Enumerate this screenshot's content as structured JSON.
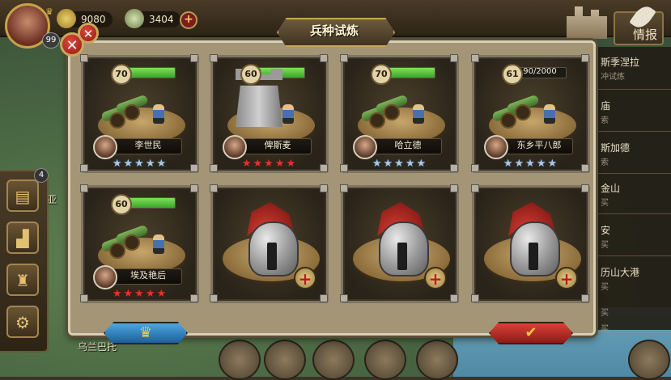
{
  "top_bar": {
    "player_level": "99",
    "gold": "9080",
    "food": "3404"
  },
  "right_panel": {
    "intel_label": "情报",
    "items": [
      {
        "title": "斯季涅拉",
        "sub": "冲试炼"
      },
      {
        "title": "庙",
        "sub": "索"
      },
      {
        "title": "斯加德",
        "sub": "索"
      },
      {
        "title": "金山",
        "sub": "买"
      },
      {
        "title": "安",
        "sub": "买"
      },
      {
        "title": "历山大港",
        "sub": "买"
      },
      {
        "title": "",
        "sub": "买"
      },
      {
        "title": "",
        "sub": "买"
      }
    ]
  },
  "left_panel": {
    "badge_count": "4",
    "map_label_1": "伯利亚",
    "map_label_2": "乌兰巴托"
  },
  "panel": {
    "title": "兵种试炼",
    "close_symbol": "✕",
    "cards": [
      {
        "level": "70",
        "progress": 1.0,
        "progress_text": "",
        "name": "李世民",
        "stars": "★★★★★",
        "star_color": "blue",
        "unit": "cannon"
      },
      {
        "level": "60",
        "progress": 1.0,
        "progress_text": "",
        "name": "俾斯麦",
        "stars": "★★★★★",
        "star_color": "red",
        "unit": "tower"
      },
      {
        "level": "70",
        "progress": 1.0,
        "progress_text": "",
        "name": "哈立德",
        "stars": "★★★★★",
        "star_color": "blue",
        "unit": "cannon"
      },
      {
        "level": "61",
        "progress": 0.045,
        "progress_text": "90/2000",
        "name": "东乡平八郎",
        "stars": "★★★★★",
        "star_color": "blue",
        "unit": "cannon"
      },
      {
        "level": "60",
        "progress": 1.0,
        "progress_text": "",
        "name": "埃及艳后",
        "stars": "★★★★★",
        "star_color": "red",
        "unit": "cannon"
      }
    ],
    "locked_slots": 3,
    "plus_symbol": "+",
    "crown_symbol": "♛",
    "check_symbol": "✔"
  },
  "colors": {
    "accent_red": "#e0342d",
    "star_blue": "#a8c8e4",
    "bar_green": "#4bbf34"
  }
}
